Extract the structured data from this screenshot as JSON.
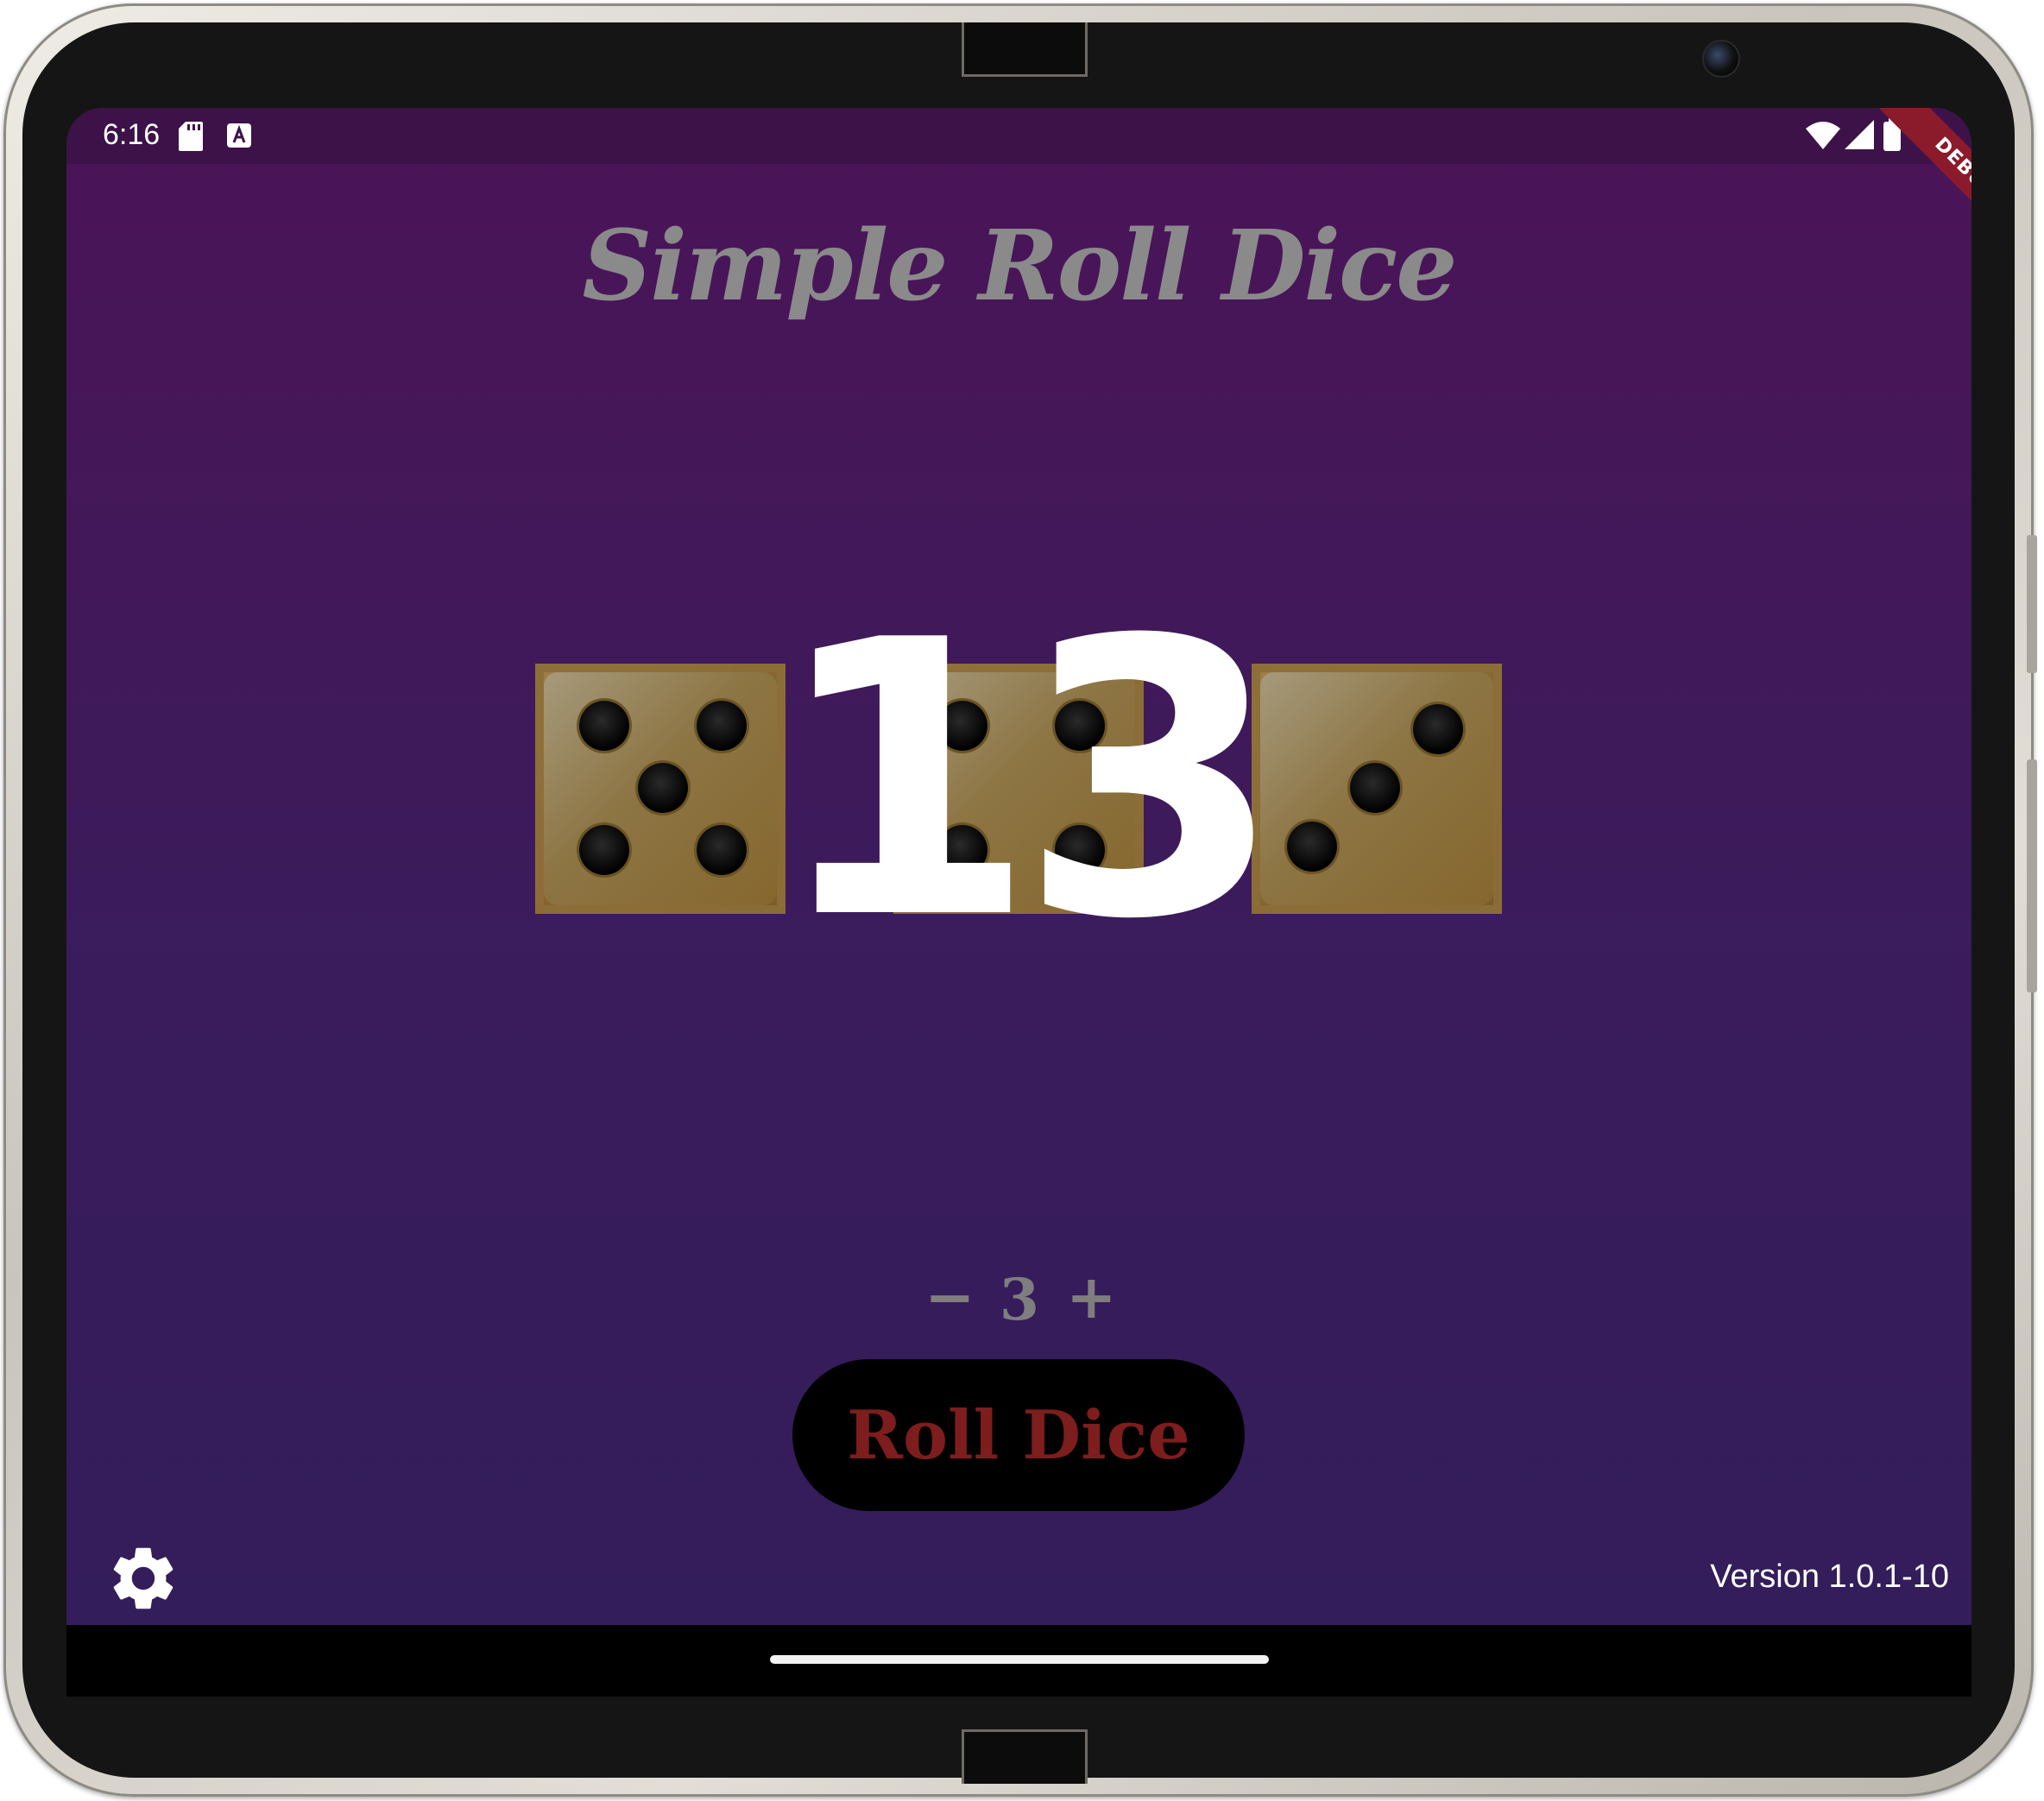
{
  "status_bar": {
    "time": "6:16",
    "icons": [
      "sd-card-icon",
      "a-text-icon",
      "wifi-icon",
      "cell-signal-icon",
      "battery-icon"
    ]
  },
  "debug_banner": "DEBUG",
  "app": {
    "title": "Simple Roll Dice",
    "dice": [
      5,
      4,
      3
    ],
    "total": "13",
    "dice_count": "3",
    "minus_label": "−",
    "plus_label": "+",
    "roll_button_label": "Roll Dice",
    "version": "Version 1.0.1-10"
  },
  "colors": {
    "background_top": "#4b1457",
    "background_bottom": "#321d5a",
    "roll_button_bg": "#000000",
    "roll_button_text": "#7e1d1d",
    "title_text": "#8a8a8a",
    "die_color": "#8d7544"
  }
}
